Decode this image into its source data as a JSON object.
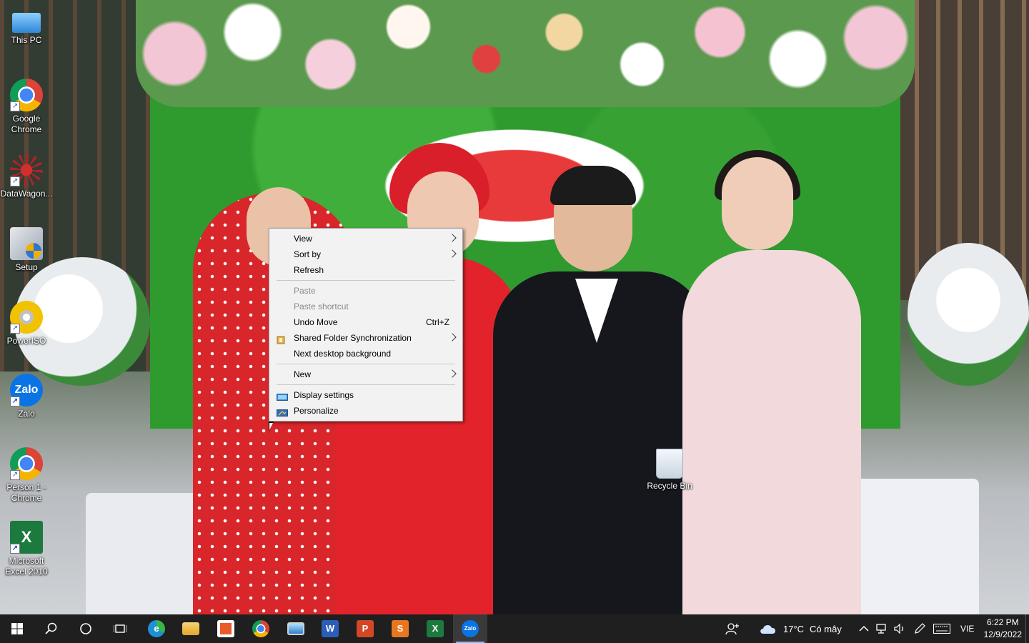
{
  "desktop": {
    "icons": [
      {
        "label": "This PC",
        "shortcut": false
      },
      {
        "label": "Google Chrome",
        "shortcut": true
      },
      {
        "label": "DataWagon...",
        "shortcut": true
      },
      {
        "label": "Setup",
        "shortcut": false
      },
      {
        "label": "PowerISO",
        "shortcut": true
      },
      {
        "label": "Zalo",
        "shortcut": true
      },
      {
        "label": "Person 1 - Chrome",
        "shortcut": true
      },
      {
        "label": "Microsoft Excel 2010",
        "shortcut": true
      },
      {
        "label": "Recycle Bin",
        "shortcut": false
      }
    ],
    "zalo_glyph": "Zalo",
    "excel_glyph": "X",
    "shortcut_glyph": "↗"
  },
  "context_menu": {
    "items": [
      {
        "label": "View",
        "submenu": true
      },
      {
        "label": "Sort by",
        "submenu": true
      },
      {
        "label": "Refresh"
      },
      {
        "label": "Paste",
        "disabled": true
      },
      {
        "label": "Paste shortcut",
        "disabled": true
      },
      {
        "label": "Undo Move",
        "shortcut": "Ctrl+Z"
      },
      {
        "label": "Shared Folder Synchronization",
        "submenu": true,
        "icon": "sync-folder-icon"
      },
      {
        "label": "Next desktop background"
      },
      {
        "label": "New",
        "submenu": true
      },
      {
        "label": "Display settings",
        "icon": "display-icon"
      },
      {
        "label": "Personalize",
        "icon": "personalize-icon"
      }
    ]
  },
  "taskbar": {
    "apps": [
      {
        "name": "edge-icon",
        "glyph": "e",
        "color": "#1e90d8"
      },
      {
        "name": "file-explorer-icon",
        "glyph": "",
        "color": "#f2c14e"
      },
      {
        "name": "store-icon",
        "glyph": "",
        "color": "#ffffff"
      },
      {
        "name": "chrome-icon",
        "glyph": "",
        "color": "#db4437"
      },
      {
        "name": "remote-desktop-icon",
        "glyph": "",
        "color": "#4aa3df"
      },
      {
        "name": "word-icon",
        "glyph": "W",
        "color": "#2b5eb8"
      },
      {
        "name": "powerpoint-icon",
        "glyph": "P",
        "color": "#d24726"
      },
      {
        "name": "slides-icon",
        "glyph": "S",
        "color": "#e8761f"
      },
      {
        "name": "excel-icon",
        "glyph": "X",
        "color": "#1d7a3e"
      },
      {
        "name": "zalo-icon",
        "glyph": "Zalo",
        "color": "#0b74e5",
        "active": true
      }
    ],
    "weather": {
      "temp": "17°C",
      "text": "Có mây"
    },
    "language": "VIE",
    "time": "6:22 PM",
    "date": "12/9/2022"
  }
}
